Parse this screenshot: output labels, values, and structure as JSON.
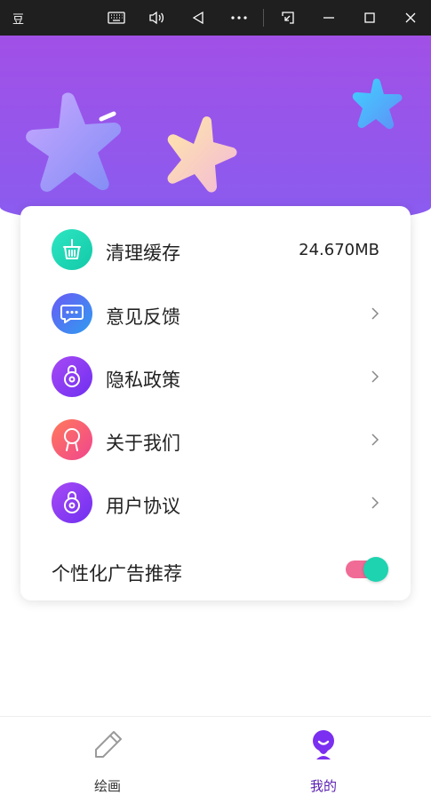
{
  "titlebar": {
    "app_title": "豆",
    "icons": [
      "keyboard-icon",
      "volume-icon",
      "back-icon",
      "more-icon",
      "screenshot-icon",
      "minimize-icon",
      "maximize-icon",
      "close-icon"
    ]
  },
  "menu": {
    "items": [
      {
        "label": "清理缓存",
        "value": "24.670MB",
        "icon": "broom-basket-icon",
        "color": "#19d6b0"
      },
      {
        "label": "意见反馈",
        "icon": "chat-bubble-icon",
        "color": "#4f7bf0"
      },
      {
        "label": "隐私政策",
        "icon": "lock-icon",
        "color": "#8a3ef0"
      },
      {
        "label": "关于我们",
        "icon": "ribbon-icon",
        "color": "#f2567e"
      },
      {
        "label": "用户协议",
        "icon": "lock-icon",
        "color": "#8a3ef0"
      }
    ],
    "ad_toggle": {
      "label": "个性化广告推荐",
      "enabled": true
    }
  },
  "bottom_nav": {
    "tabs": [
      {
        "label": "绘画",
        "icon": "pencil-icon",
        "active": false
      },
      {
        "label": "我的",
        "icon": "profile-icon",
        "active": true
      }
    ]
  },
  "colors": {
    "accent": "#7b2ff0",
    "toggle_track": "#f06b95",
    "toggle_knob": "#1dd3b0"
  }
}
